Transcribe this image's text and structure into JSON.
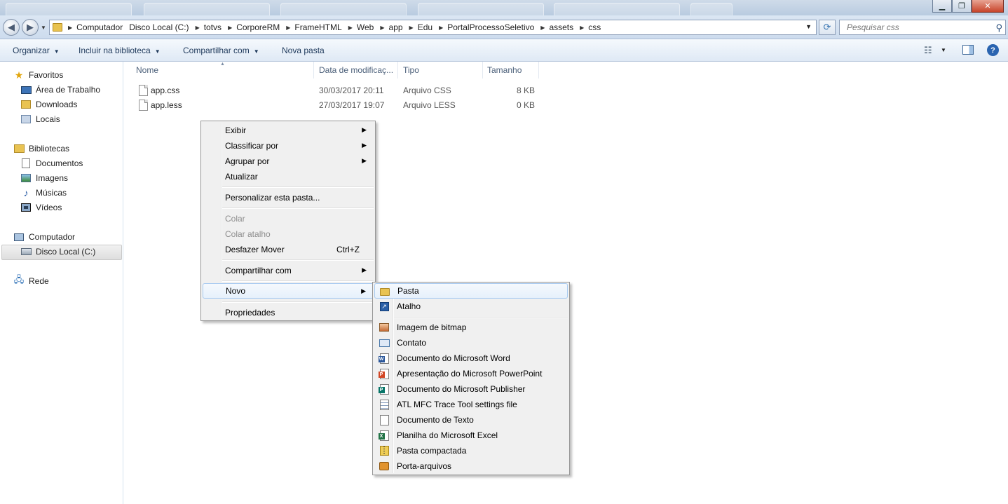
{
  "window": {
    "controls": {
      "minimize": "▁",
      "maximize": "❐",
      "close": "✕"
    }
  },
  "address": {
    "breadcrumbs": [
      "Computador",
      "Disco Local (C:)",
      "totvs",
      "CorporeRM",
      "FrameHTML",
      "Web",
      "app",
      "Edu",
      "PortalProcessoSeletivo",
      "assets",
      "css"
    ],
    "search_placeholder": "Pesquisar css"
  },
  "toolbar": {
    "organize": "Organizar",
    "include_library": "Incluir na biblioteca",
    "share_with": "Compartilhar com",
    "new_folder": "Nova pasta"
  },
  "nav": {
    "favorites": {
      "label": "Favoritos",
      "items": [
        "Área de Trabalho",
        "Downloads",
        "Locais"
      ]
    },
    "libraries": {
      "label": "Bibliotecas",
      "items": [
        "Documentos",
        "Imagens",
        "Músicas",
        "Vídeos"
      ]
    },
    "computer": {
      "label": "Computador",
      "items": [
        "Disco Local (C:)"
      ]
    },
    "network": {
      "label": "Rede"
    }
  },
  "columns": [
    "Nome",
    "Data de modificaç...",
    "Tipo",
    "Tamanho"
  ],
  "files": [
    {
      "name": "app.css",
      "date": "30/03/2017 20:11",
      "type": "Arquivo CSS",
      "size": "8 KB"
    },
    {
      "name": "app.less",
      "date": "27/03/2017 19:07",
      "type": "Arquivo LESS",
      "size": "0 KB"
    }
  ],
  "context_menu": {
    "view": "Exibir",
    "sort_by": "Classificar por",
    "group_by": "Agrupar por",
    "refresh": "Atualizar",
    "customize": "Personalizar esta pasta...",
    "paste": "Colar",
    "paste_shortcut": "Colar atalho",
    "undo_move": "Desfazer Mover",
    "undo_shortcut": "Ctrl+Z",
    "share_with": "Compartilhar com",
    "new": "Novo",
    "properties": "Propriedades"
  },
  "new_submenu": {
    "folder": "Pasta",
    "shortcut": "Atalho",
    "bitmap": "Imagem de bitmap",
    "contact": "Contato",
    "word": "Documento do Microsoft Word",
    "powerpoint": "Apresentação do Microsoft PowerPoint",
    "publisher": "Documento do Microsoft Publisher",
    "atl": "ATL MFC Trace Tool settings file",
    "text": "Documento de Texto",
    "excel": "Planilha do Microsoft Excel",
    "zip": "Pasta compactada",
    "briefcase": "Porta-arquivos"
  },
  "colors": {
    "accent": "#2a64b0",
    "word": "#2b579a",
    "powerpoint": "#d24726",
    "publisher": "#077568",
    "excel": "#217346"
  }
}
